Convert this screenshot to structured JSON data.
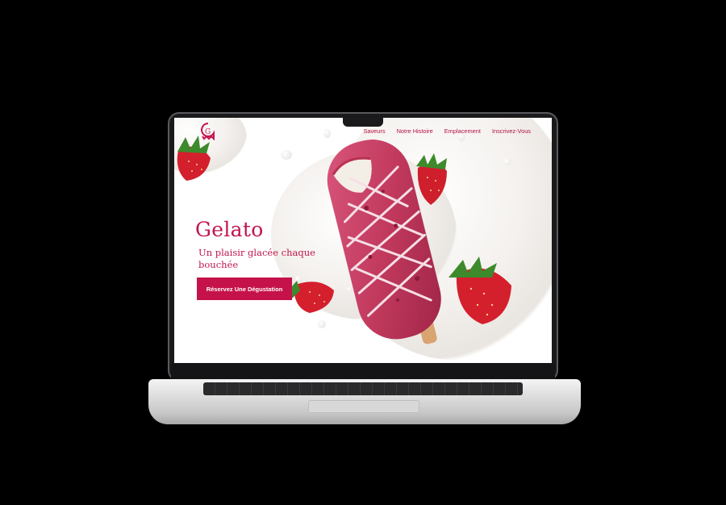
{
  "nav": {
    "items": [
      {
        "label": "Saveurs"
      },
      {
        "label": "Notre Histoire"
      },
      {
        "label": "Emplacement"
      },
      {
        "label": "Inscrivez-Vous"
      }
    ]
  },
  "logo": {
    "letter": "G"
  },
  "hero": {
    "title": "Gelato",
    "tagline": "Un plaisir glacée chaque bouchée",
    "cta_label": "Réservez Une Dégustation"
  },
  "colors": {
    "brand": "#c5124a",
    "ice_cream": "#c23a5e",
    "drizzle": "#f6dfe6",
    "cream": "#f2efec"
  }
}
